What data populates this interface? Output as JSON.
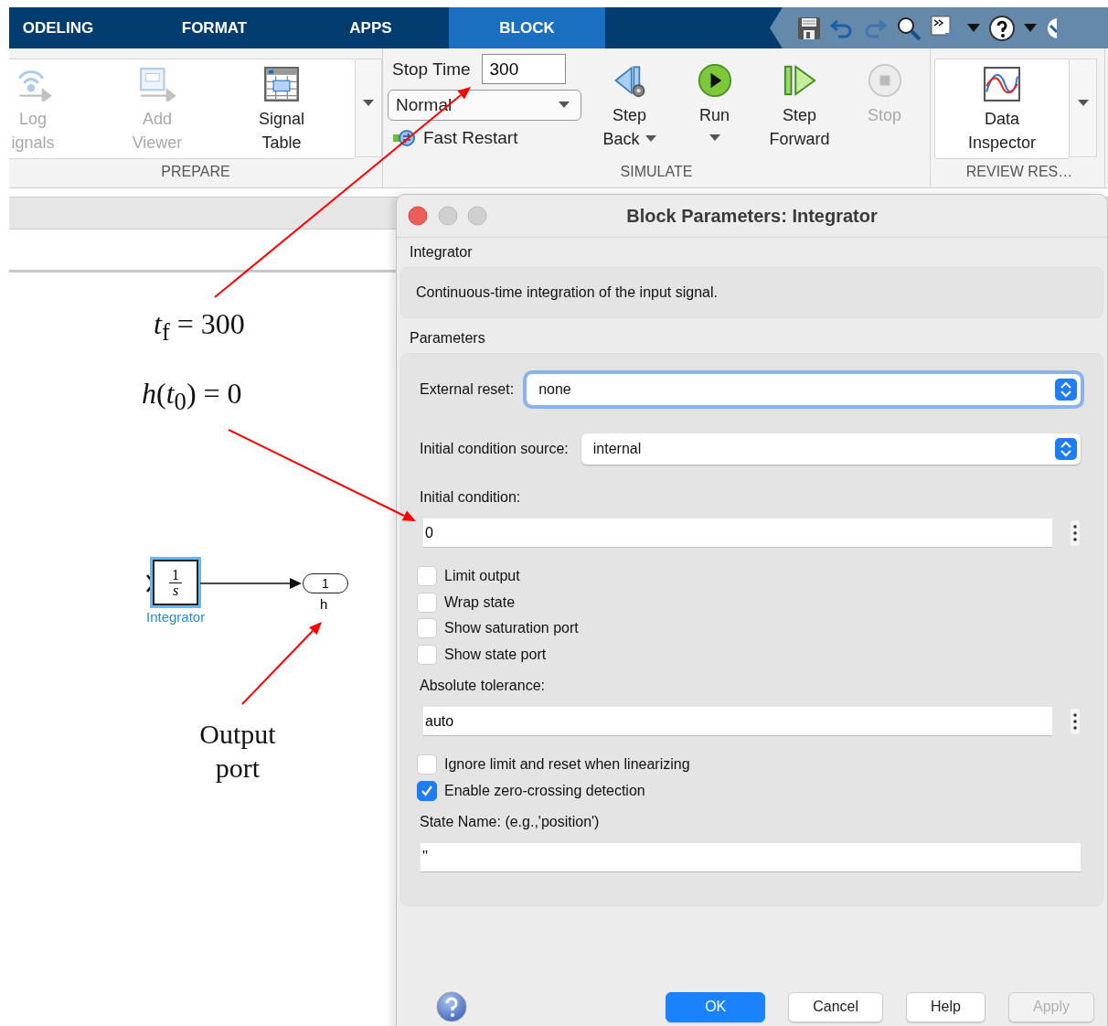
{
  "tabs": [
    {
      "label": "ODELING",
      "selected": false
    },
    {
      "label": "FORMAT",
      "selected": false
    },
    {
      "label": "APPS",
      "selected": false
    },
    {
      "label": "BLOCK",
      "selected": true
    }
  ],
  "ribbon": {
    "prepare": {
      "title": "PREPARE",
      "buttons": [
        {
          "kind": "log",
          "lines": [
            "Log",
            "ignals"
          ],
          "disabled": true,
          "menu": false
        },
        {
          "kind": "viewer",
          "lines": [
            "Add",
            "Viewer"
          ],
          "disabled": true,
          "menu": false
        },
        {
          "kind": "table",
          "lines": [
            "Signal",
            "Table"
          ],
          "disabled": false,
          "menu": false
        }
      ]
    },
    "simulate": {
      "title": "SIMULATE",
      "stop_time_label": "Stop Time",
      "stop_time": "300",
      "mode": "Normal",
      "fast_restart": "Fast Restart",
      "buttons": [
        {
          "kind": "step_back",
          "lines": [
            "Step",
            "Back"
          ],
          "disabled": false,
          "menu": true
        },
        {
          "kind": "run",
          "lines": [
            "Run"
          ],
          "disabled": false,
          "menu": true
        },
        {
          "kind": "step_forward",
          "lines": [
            "Step",
            "Forward"
          ],
          "disabled": false,
          "menu": false
        },
        {
          "kind": "stop",
          "lines": [
            "Stop"
          ],
          "disabled": true,
          "menu": false
        }
      ]
    },
    "review": {
      "title": "REVIEW RES…",
      "buttons": [
        {
          "kind": "inspector",
          "lines": [
            "Data",
            "Inspector"
          ],
          "disabled": false,
          "menu": false
        }
      ]
    }
  },
  "canvas": {
    "block": {
      "numerator": "1",
      "denominator": "s",
      "name": "Integrator",
      "selected": true
    },
    "outport": {
      "number": "1",
      "name": "h"
    }
  },
  "annotations": [
    {
      "kind": "math",
      "text": "*t*$_{f}$ = 300"
    },
    {
      "kind": "math",
      "text": "*h*(*t*$_{0}$) = 0"
    },
    {
      "kind": "label",
      "text": "Output port"
    }
  ],
  "dialog": {
    "title": "Block Parameters: Integrator",
    "block_type": "Integrator",
    "description": "Continuous-time integration of the input signal.",
    "section": "Parameters",
    "params": [
      {
        "kind": "select",
        "label": "External reset:",
        "value": "none",
        "focused": true
      },
      {
        "kind": "select",
        "label": "Initial condition source:",
        "value": "internal",
        "focused": false
      },
      {
        "kind": "text",
        "label": "Initial condition:",
        "value": "0",
        "menu": true
      },
      {
        "kind": "checkbox",
        "label": "Limit output",
        "checked": false
      },
      {
        "kind": "checkbox",
        "label": "Wrap state",
        "checked": false
      },
      {
        "kind": "checkbox",
        "label": "Show saturation port",
        "checked": false
      },
      {
        "kind": "checkbox",
        "label": "Show state port",
        "checked": false
      },
      {
        "kind": "text",
        "label": "Absolute tolerance:",
        "value": "auto",
        "menu": true
      },
      {
        "kind": "checkbox",
        "label": "Ignore limit and reset when linearizing",
        "checked": false
      },
      {
        "kind": "checkbox",
        "label": "Enable zero-crossing detection",
        "checked": true
      },
      {
        "kind": "text",
        "label": "State Name: (e.g.,'position')",
        "value": "''",
        "menu": false
      }
    ],
    "buttons": [
      {
        "label": "OK",
        "kind": "primary",
        "disabled": false
      },
      {
        "label": "Cancel",
        "kind": "normal",
        "disabled": false
      },
      {
        "label": "Help",
        "kind": "normal",
        "disabled": false
      },
      {
        "label": "Apply",
        "kind": "normal",
        "disabled": true
      }
    ]
  }
}
